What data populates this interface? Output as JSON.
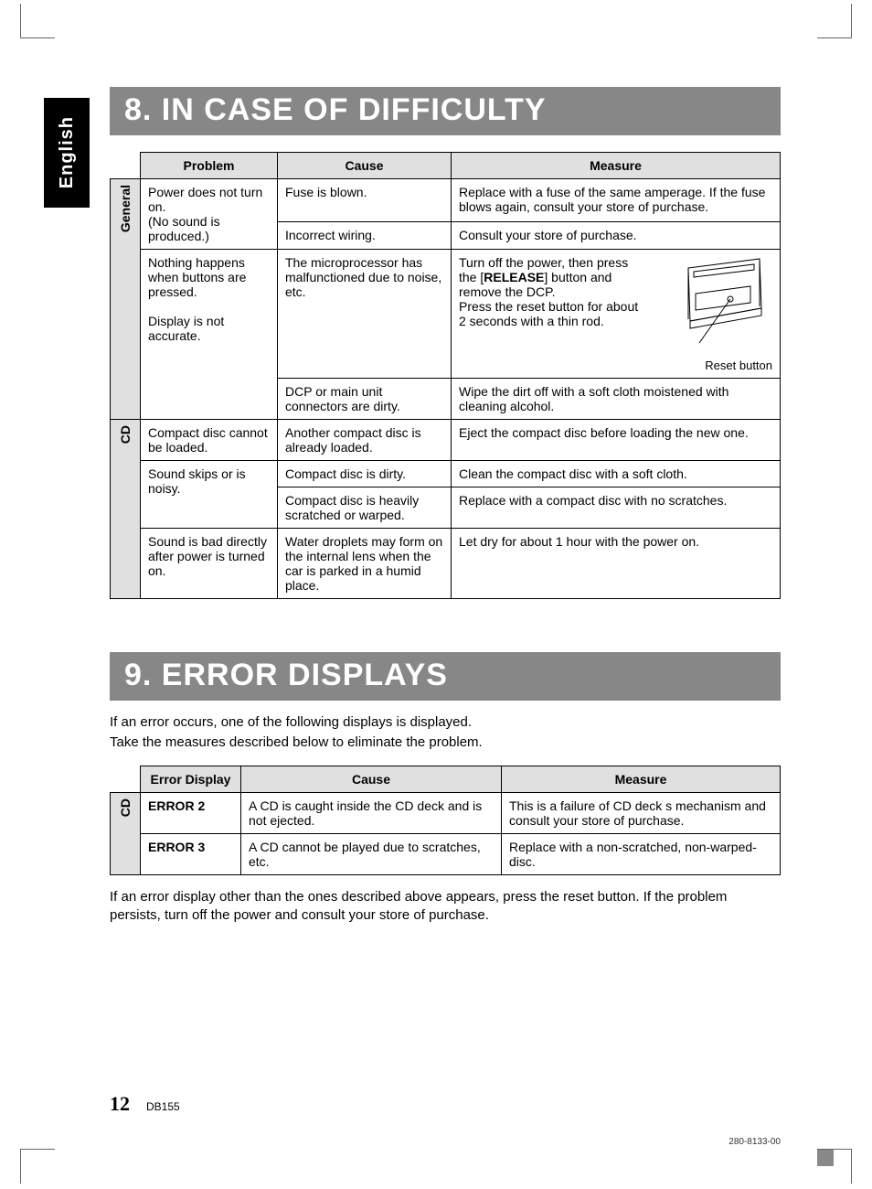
{
  "side_tab": "English",
  "section8": {
    "title": "8. IN CASE OF DIFFICULTY",
    "headers": {
      "problem": "Problem",
      "cause": "Cause",
      "measure": "Measure"
    },
    "cat_general": "General",
    "cat_cd": "CD",
    "rows": {
      "g1": {
        "problem": "Power does not turn on.\n(No sound is produced.)",
        "cause1": "Fuse is blown.",
        "measure1": "Replace with a fuse of the same amperage. If the fuse blows again, consult your store of purchase.",
        "cause2": "Incorrect wiring.",
        "measure2": "Consult your store of purchase."
      },
      "g2": {
        "problem": "Nothing happens when buttons are pressed.\n\nDisplay is not accurate.",
        "cause1": "The microprocessor has malfunctioned due to noise, etc.",
        "measure1_pre": "Turn off the power, then press the [",
        "measure1_bold": "RELEASE",
        "measure1_post": "] button and remove the DCP.\nPress the reset button for about 2 seconds with a thin rod.",
        "fig_caption": "Reset button",
        "cause2": "DCP or main unit connectors are dirty.",
        "measure2": "Wipe the dirt off with a soft cloth moistened with cleaning alcohol."
      },
      "c1": {
        "problem": "Compact disc cannot be loaded.",
        "cause": "Another compact disc is already loaded.",
        "measure": "Eject the compact disc before loading the new one."
      },
      "c2": {
        "problem": "Sound skips or is noisy.",
        "cause1": "Compact disc is dirty.",
        "measure1": "Clean the compact disc with a soft cloth.",
        "cause2": "Compact disc is heavily scratched or warped.",
        "measure2": "Replace with a compact disc with no scratches."
      },
      "c3": {
        "problem": "Sound is bad directly after power is turned on.",
        "cause": "Water droplets may form on the internal lens when the car is parked in a humid place.",
        "measure": "Let dry for about 1 hour with the power on."
      }
    }
  },
  "section9": {
    "title": "9. ERROR DISPLAYS",
    "intro1": "If an error occurs, one of the following displays is displayed.",
    "intro2": "Take the measures described below to eliminate the problem.",
    "headers": {
      "errdisp": "Error Display",
      "cause": "Cause",
      "measure": "Measure"
    },
    "cat_cd": "CD",
    "rows": {
      "e2": {
        "name": "ERROR 2",
        "cause": "A CD is caught inside the CD deck and is not ejected.",
        "measure": "This is a failure of CD deck s mechanism and consult your store of purchase."
      },
      "e3": {
        "name": "ERROR 3",
        "cause": "A CD cannot be played due to scratches, etc.",
        "measure": "Replace with a non-scratched, non-warped-disc."
      }
    },
    "outro": "If an error display other than the ones described above appears, press the reset button. If the problem persists, turn off the power and consult your store of purchase."
  },
  "footer": {
    "page": "12",
    "model": "DB155"
  },
  "doc_code": "280-8133-00"
}
